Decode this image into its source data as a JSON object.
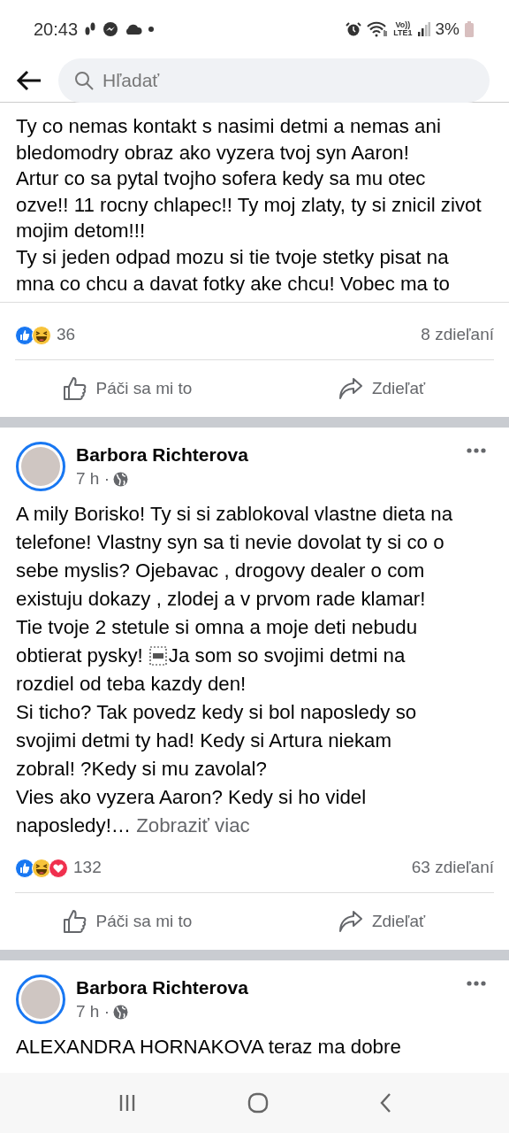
{
  "status_bar": {
    "time": "20:43",
    "network_label": [
      "Vo))",
      "LTE1"
    ],
    "battery": "3%"
  },
  "search": {
    "placeholder": "Hľadať"
  },
  "posts": [
    {
      "lines": [
        [
          "Ty co nemas kontakt s nasimi detmi a nemas ani"
        ],
        [
          "bledomodry obraz ako vyzera tvoj syn Aaron!"
        ],
        [
          "Artur co sa pytal tvojho sofera kedy sa mu otec"
        ],
        [
          "ozve!! 11 rocny chlapec!! Ty moj zlaty, ty si znicil zivot"
        ],
        [
          "mojim detom!!!"
        ],
        [
          "Ty si jeden odpad mozu si tie tvoje stetky pisat na"
        ],
        [
          "mna co chcu a davat fotky ake chcu! Vobec ma to"
        ]
      ],
      "reactions": [
        {
          "kind": "like"
        },
        {
          "kind": "haha"
        }
      ],
      "reaction_count": "36",
      "shares": "8 zdieľaní",
      "like_label": "Páči sa mi to",
      "share_label": "Zdieľať"
    },
    {
      "author": "Barbora Richterova",
      "time": "7 h ·",
      "lines": [
        [
          "A mily Borisko! Ty si si zablokoval vlastne dieta na"
        ],
        [
          "telefone! Vlastny syn sa ti nevie dovolat ty si co o"
        ],
        [
          "sebe myslis? Ojebavac , drogovy dealer o com"
        ],
        [
          "existuju dokazy , zlodej a v prvom rade klamar!"
        ],
        [
          "Tie tvoje 2 stetule si omna a moje deti nebudu"
        ],
        [
          "obtierat pysky!",
          "Ja som so svojimi detmi na"
        ],
        [
          "rozdiel od teba kazdy den!"
        ],
        [
          "Si ticho? Tak povedz kedy si bol naposledy so"
        ],
        [
          "svojimi detmi ty had! Kedy si Artura niekam"
        ],
        [
          "zobral! ?Kedy si mu zavolal?"
        ],
        [
          "Vies ako vyzera Aaron? Kedy si ho videl"
        ],
        [
          "naposledy!…"
        ]
      ],
      "see_more": "Zobraziť viac",
      "reactions": [
        {
          "kind": "like"
        },
        {
          "kind": "haha"
        },
        {
          "kind": "love"
        }
      ],
      "reaction_count": "132",
      "shares": "63 zdieľaní",
      "like_label": "Páči sa mi to",
      "share_label": "Zdieľať"
    },
    {
      "author": "Barbora Richterova",
      "time": "7 h ·",
      "lines": [
        [
          "ALEXANDRA HORNAKOVA teraz ma dobre"
        ]
      ]
    }
  ]
}
